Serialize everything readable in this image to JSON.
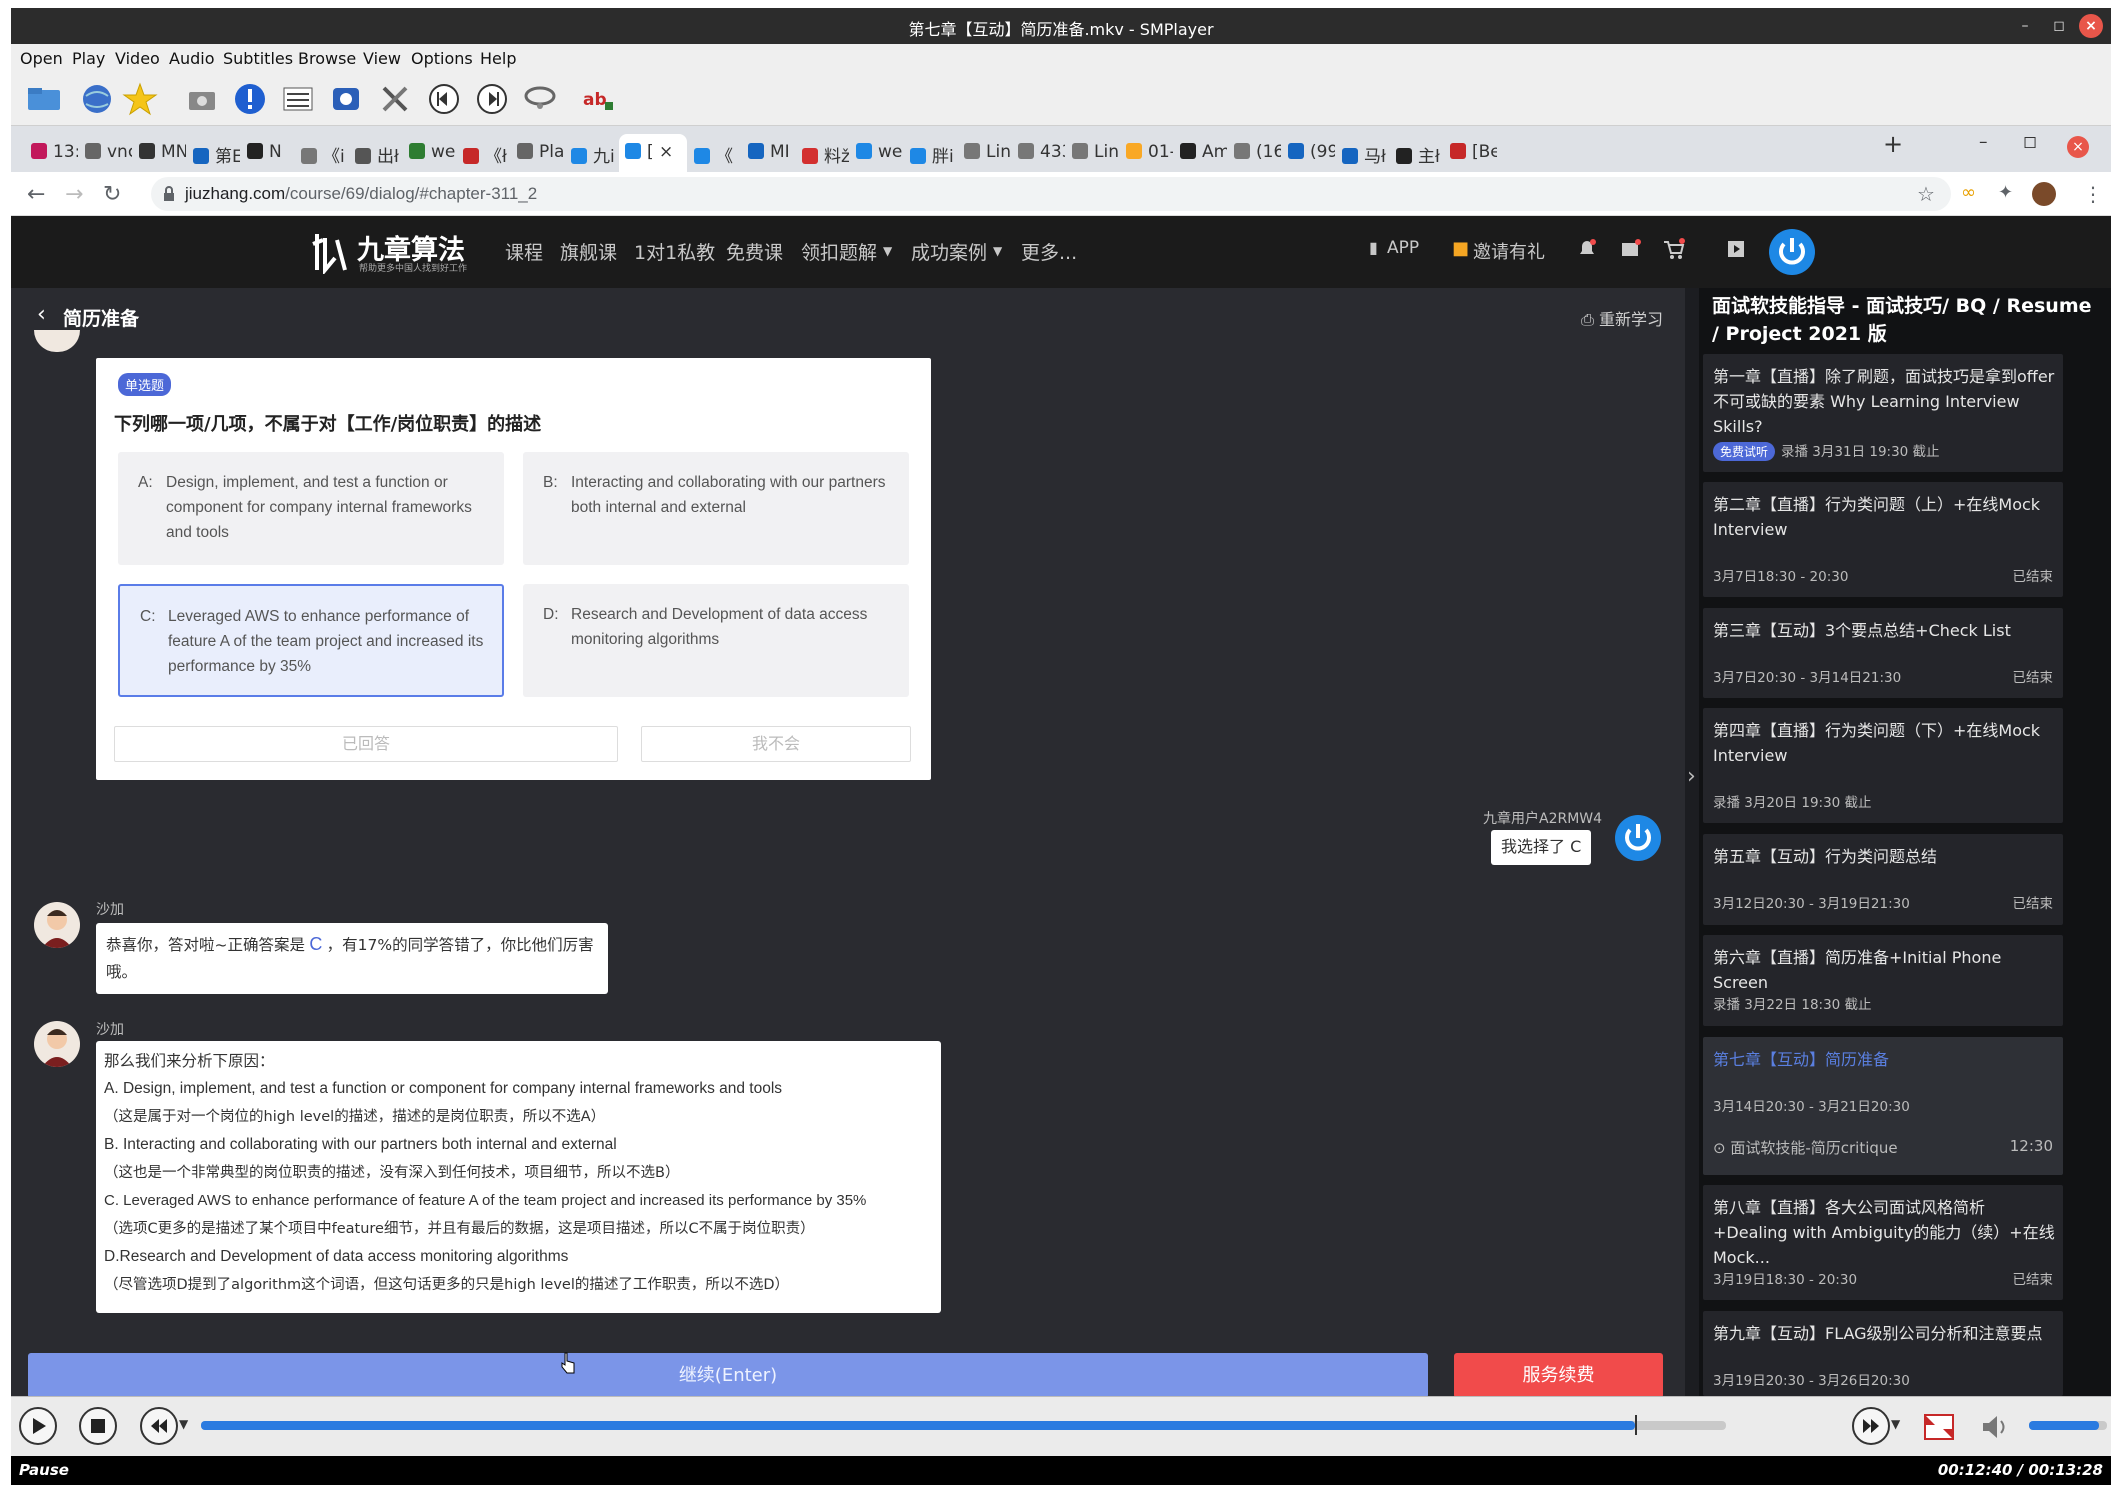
{
  "window": {
    "title": "第七章【互动】简历准备.mkv - SMPlayer"
  },
  "menubar": [
    "Open",
    "Play",
    "Video",
    "Audio",
    "Subtitles",
    "Browse",
    "View",
    "Options",
    "Help"
  ],
  "browser": {
    "tabs": [
      {
        "label": "13:",
        "color": "#c2185b"
      },
      {
        "label": "vnc",
        "color": "#666666"
      },
      {
        "label": "MN",
        "color": "#333333"
      },
      {
        "label": "第E",
        "color": "#1565c0"
      },
      {
        "label": "N",
        "color": "#222222"
      },
      {
        "label": "《i",
        "color": "#777777"
      },
      {
        "label": "出ł",
        "color": "#555555"
      },
      {
        "label": "wei",
        "color": "#2e7d32"
      },
      {
        "label": "《ł",
        "color": "#c62828"
      },
      {
        "label": "Pla",
        "color": "#666666"
      },
      {
        "label": "九i",
        "color": "#1e88e5"
      },
      {
        "label": "[",
        "color": "#1e88e5"
      },
      {
        "label": "《",
        "color": "#1e88e5"
      },
      {
        "label": "MI",
        "color": "#1565c0"
      },
      {
        "label": "料ž",
        "color": "#d32f2f"
      },
      {
        "label": "wei",
        "color": "#1e88e5"
      },
      {
        "label": "胖i",
        "color": "#1e88e5"
      },
      {
        "label": "Lin",
        "color": "#777777"
      },
      {
        "label": "433",
        "color": "#777777"
      },
      {
        "label": "Lin",
        "color": "#777777"
      },
      {
        "label": "01-",
        "color": "#f9a825"
      },
      {
        "label": "Am",
        "color": "#222222"
      },
      {
        "label": "(16",
        "color": "#777777"
      },
      {
        "label": "(99",
        "color": "#1565c0"
      },
      {
        "label": "马ł",
        "color": "#1565c0"
      },
      {
        "label": "主ł",
        "color": "#222222"
      },
      {
        "label": "[Be",
        "color": "#c62828"
      }
    ],
    "url_host": "jiuzhang.com",
    "url_path": "/course/69/dialog/#chapter-311_2"
  },
  "site": {
    "logo": "九章算法",
    "logo_sub": "帮助更多中国人找到好工作",
    "nav": [
      "课程",
      "旗舰课",
      "1对1私教",
      "免费课",
      "领扣题解",
      "成功案例",
      "更多..."
    ],
    "app_label": "APP",
    "invite_label": "邀请有礼"
  },
  "chat": {
    "header_title": "简历准备",
    "restart_label": "重新学习",
    "quiz": {
      "tag": "单选题",
      "question": "下列哪一项/几项，不属于对【工作/岗位职责】的描述",
      "options": [
        {
          "key": "A:",
          "text": "Design, implement, and test a function or component for company internal frameworks and tools"
        },
        {
          "key": "B:",
          "text": "Interacting and collaborating with our partners both internal and external"
        },
        {
          "key": "C:",
          "text": "Leveraged AWS to enhance performance of feature A of the team project and increased its performance by 35%"
        },
        {
          "key": "D:",
          "text": "Research and Development of data access monitoring algorithms"
        }
      ],
      "answered_label": "已回答",
      "dont_know_label": "我不会"
    },
    "user_name": "九章用户A2RMW4",
    "user_reply": "我选择了 C",
    "bot_name": "沙加",
    "msg1_pre": "恭喜你，答对啦~正确答案是",
    "msg1_ans": "C",
    "msg1_post": "，有17%的同学答错了，你比他们厉害哦。",
    "msg2_lines": [
      "那么我们来分析下原因：",
      "A. Design, implement, and test a function or component for company internal frameworks and tools",
      "（这是属于对一个岗位的high level的描述，描述的是岗位职责，所以不选A）",
      "B. Interacting and collaborating with our partners both internal and external",
      "（这也是一个非常典型的岗位职责的描述，没有深入到任何技术，项目细节，所以不选B）",
      "C. Leveraged AWS to enhance performance of feature A of the team project and increased its performance by 35%",
      "（选项C更多的是描述了某个项目中feature细节，并且有最后的数据，这是项目描述，所以C不属于岗位职责）",
      "D.Research and Development of data access monitoring algorithms",
      "（尽管选项D提到了algorithm这个词语，但这句话更多的只是high level的描述了工作职责，所以不选D）"
    ],
    "continue_label": "继续(Enter)",
    "renew_label": "服务续费"
  },
  "sidebar": {
    "course_title": "面试软技能指导 - 面试技巧/ BQ / Resume / Project 2021 版",
    "chapters": [
      {
        "title": "第一章【直播】除了刷题，面试技巧是拿到offer不可或缺的要素 Why Learning Interview Skills?",
        "badge": "免费试听",
        "date": "录播 3月31日 19:30 截止",
        "status": ""
      },
      {
        "title": "第二章【直播】行为类问题（上）+在线Mock Interview",
        "date": "3月7日18:30 - 20:30",
        "status": "已结束"
      },
      {
        "title": "第三章【互动】3个要点总结+Check List",
        "date": "3月7日20:30 - 3月14日21:30",
        "status": "已结束"
      },
      {
        "title": "第四章【直播】行为类问题（下）+在线Mock Interview",
        "date": "录播 3月20日 19:30 截止",
        "status": ""
      },
      {
        "title": "第五章【互动】行为类问题总结",
        "date": "3月12日20:30 - 3月19日21:30",
        "status": "已结束"
      },
      {
        "title": "第六章【直播】简历准备+Initial Phone Screen",
        "date": "录播 3月22日 18:30 截止",
        "status": ""
      },
      {
        "title": "第七章【互动】简历准备",
        "date": "3月14日20:30 - 3月21日20:30",
        "status": "",
        "sub": "面试软技能-简历critique",
        "sub_time": "12:30"
      },
      {
        "title": "第八章【直播】各大公司面试风格简析+Dealing with Ambiguity的能力（续）+在线Mock...",
        "date": "3月19日18:30 - 20:30",
        "status": "已结束"
      },
      {
        "title": "第九章【互动】FLAG级别公司分析和注意要点",
        "date": "3月19日20:30 - 3月26日20:30",
        "status": ""
      }
    ]
  },
  "player": {
    "status": "Pause",
    "time": "00:12:40 / 00:13:28",
    "progress": 0.94,
    "volume": 0.9
  }
}
